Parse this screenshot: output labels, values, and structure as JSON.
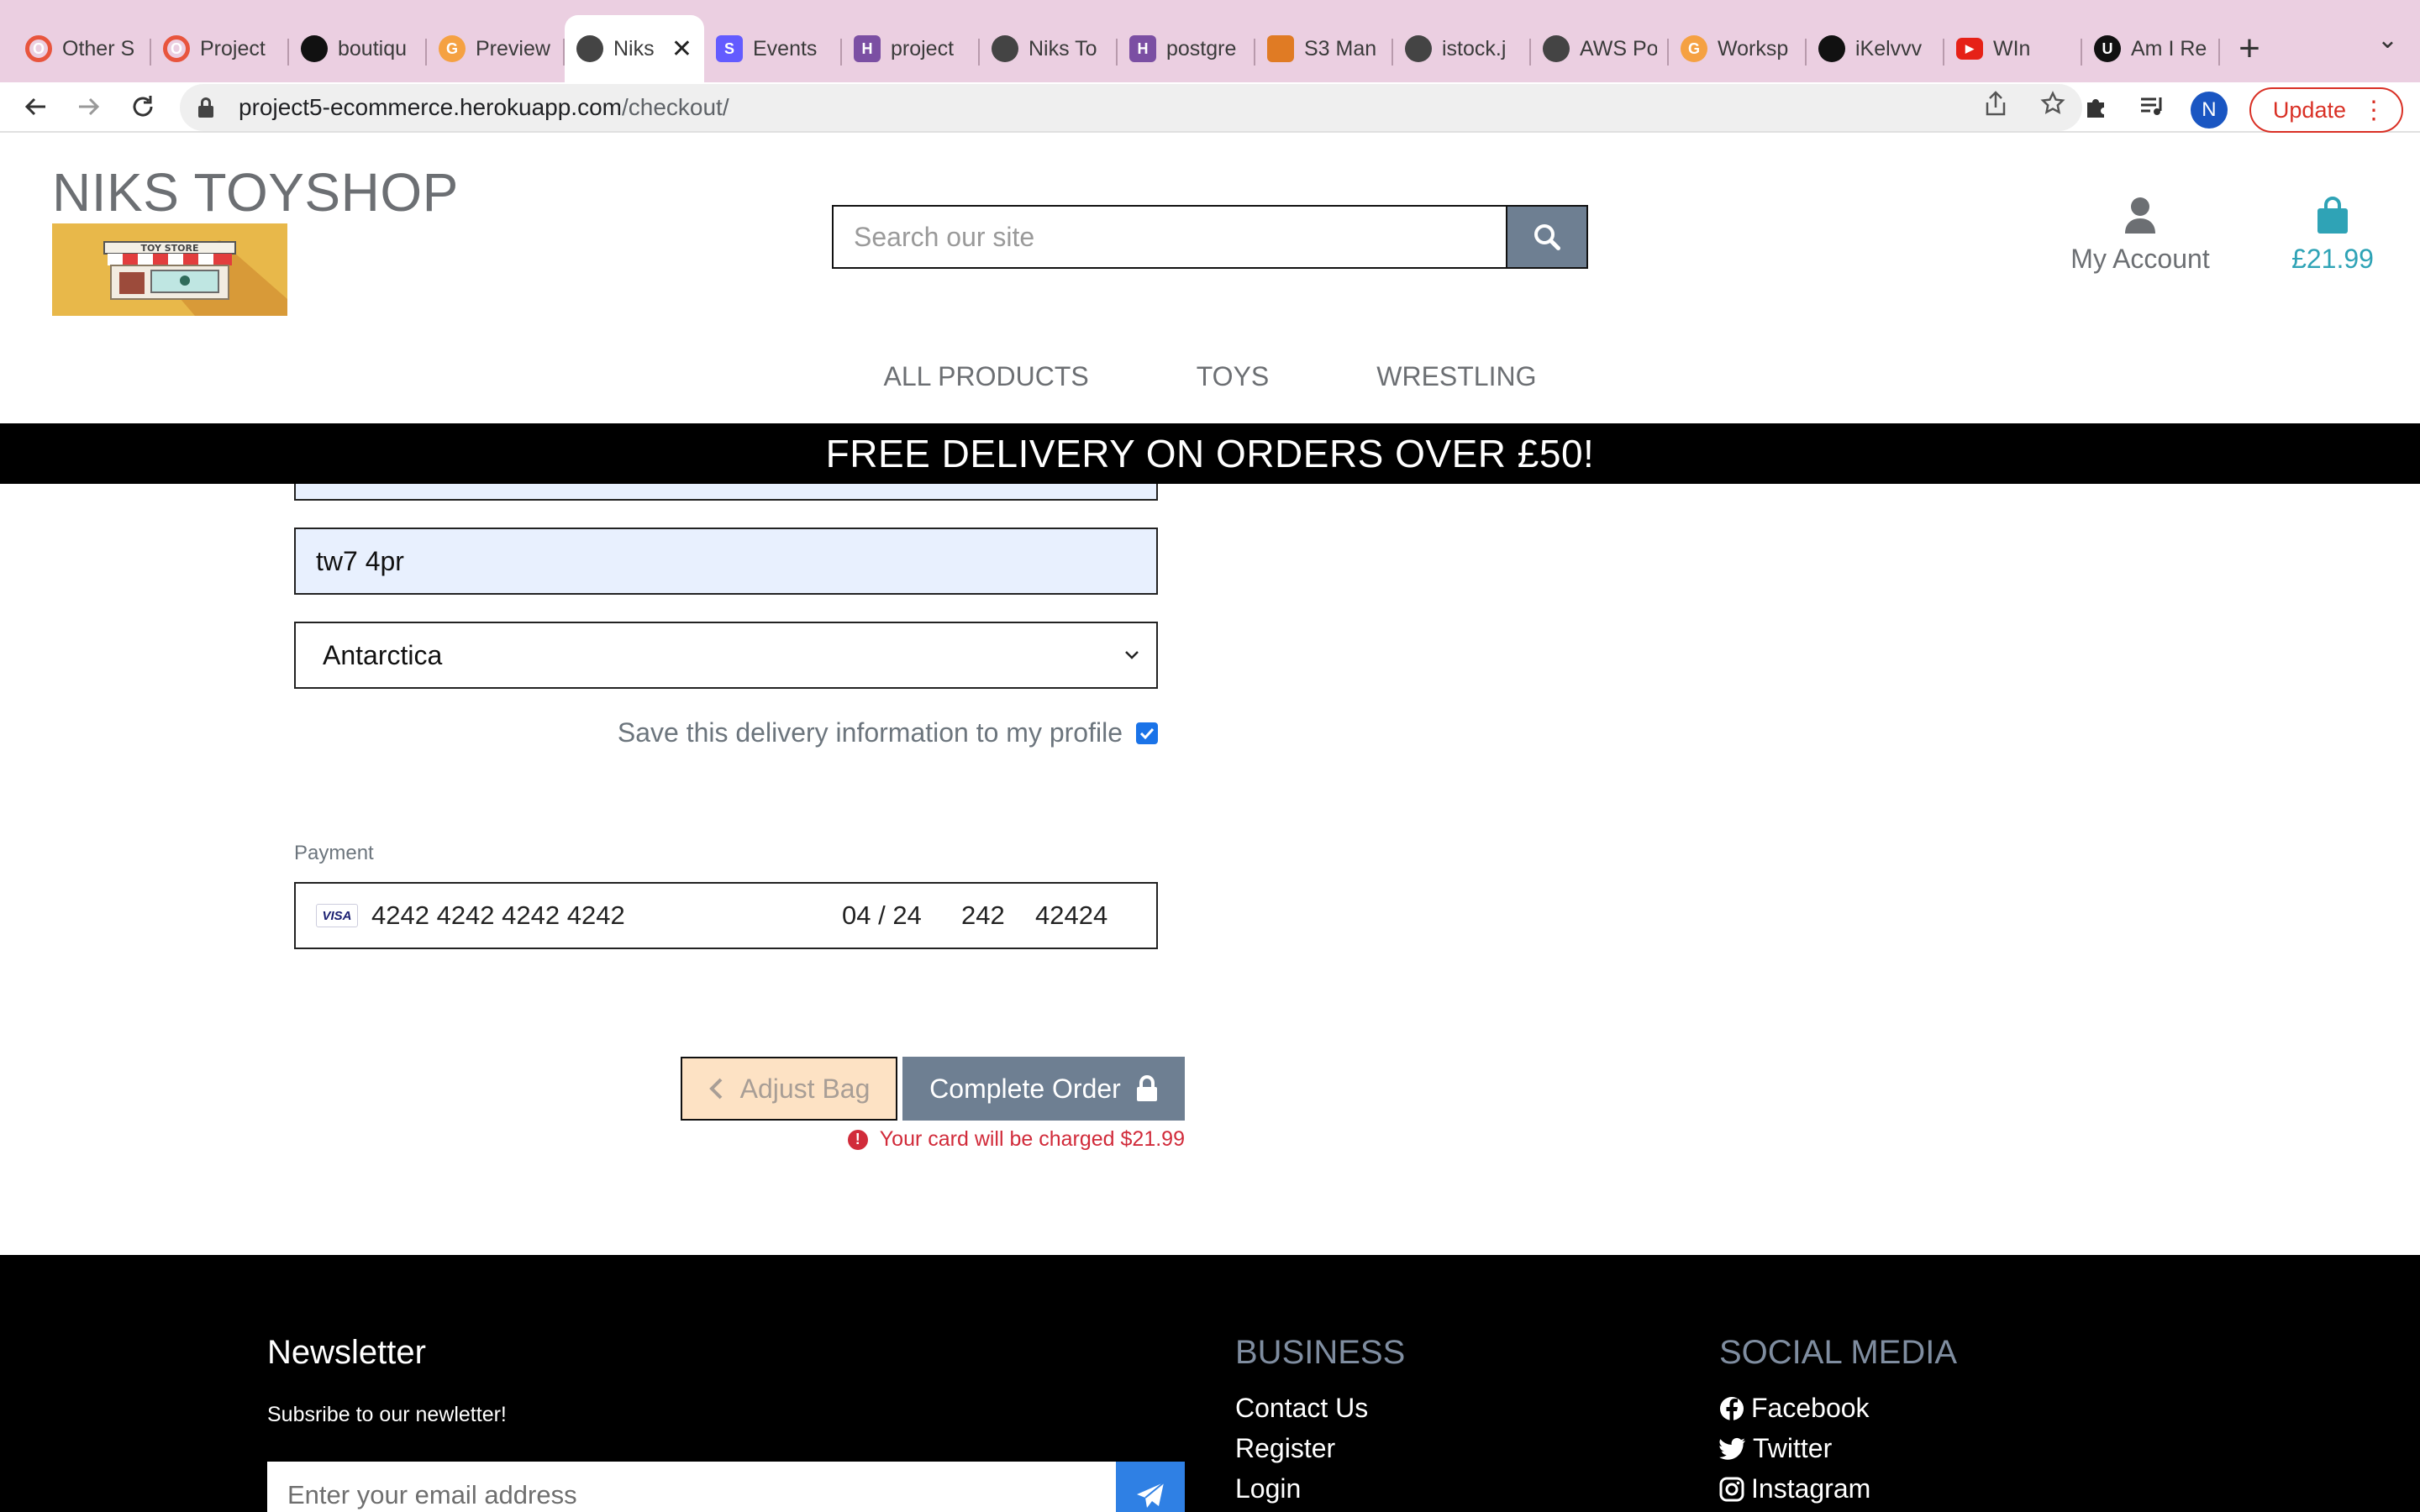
{
  "browser": {
    "tabs": [
      {
        "title": "Other S",
        "favicon": "opera-icon",
        "color": "#e8553d",
        "active": false
      },
      {
        "title": "Project",
        "favicon": "opera-icon",
        "color": "#e8553d",
        "active": false
      },
      {
        "title": "boutiqu",
        "favicon": "github-icon",
        "color": "#111111",
        "active": false
      },
      {
        "title": "Preview",
        "favicon": "gitpod-icon",
        "color": "#f5a142",
        "active": false
      },
      {
        "title": "Niks",
        "favicon": "globe-icon",
        "color": "#444444",
        "active": true
      },
      {
        "title": "Events",
        "favicon": "stripe-icon",
        "color": "#635bff",
        "active": false
      },
      {
        "title": "project",
        "favicon": "heroku-icon",
        "color": "#7b4fa3",
        "active": false
      },
      {
        "title": "Niks To",
        "favicon": "globe-icon",
        "color": "#444444",
        "active": false
      },
      {
        "title": "postgre",
        "favicon": "heroku-icon",
        "color": "#7b4fa3",
        "active": false
      },
      {
        "title": "S3 Man",
        "favicon": "aws-s3-icon",
        "color": "#e07b24",
        "active": false
      },
      {
        "title": "istock.j",
        "favicon": "globe-icon",
        "color": "#444444",
        "active": false
      },
      {
        "title": "AWS Po",
        "favicon": "globe-icon",
        "color": "#444444",
        "active": false
      },
      {
        "title": "Worksp",
        "favicon": "gitpod-icon",
        "color": "#f5a142",
        "active": false
      },
      {
        "title": "iKelvvv",
        "favicon": "github-icon",
        "color": "#111111",
        "active": false
      },
      {
        "title": "WIn",
        "favicon": "youtube-icon",
        "color": "#e62117",
        "active": false
      },
      {
        "title": "Am I Re",
        "favicon": "ui-icon",
        "color": "#111111",
        "active": false
      }
    ],
    "url_host": "project5-ecommerce.herokuapp.com",
    "url_path": "/checkout/",
    "profile_initial": "N",
    "update_label": "Update"
  },
  "site": {
    "brand": "NIKS TOYSHOP",
    "logo_text": "TOY STORE",
    "search_placeholder": "Search our site",
    "account_label": "My Account",
    "bag_total": "£21.99",
    "nav": [
      "ALL PRODUCTS",
      "TOYS",
      "WRESTLING"
    ],
    "banner": "FREE DELIVERY ON ORDERS OVER £50!"
  },
  "checkout": {
    "postcode_value": "tw7 4pr",
    "country_value": "Antarctica",
    "save_info_label": "Save this delivery information to my profile",
    "save_info_checked": true,
    "payment_label": "Payment",
    "card": {
      "brand": "VISA",
      "number": "4242 4242 4242 4242",
      "expiry": "04 / 24",
      "cvc": "242",
      "postal": "42424"
    },
    "adjust_bag_label": "Adjust Bag",
    "complete_order_label": "Complete Order",
    "charge_note": "Your card will be charged $21.99"
  },
  "footer": {
    "newsletter_title": "Newsletter",
    "newsletter_sub": "Subsribe to our newletter!",
    "email_placeholder": "Enter your email address",
    "business_title": "BUSINESS",
    "business_links": [
      "Contact Us",
      "Register",
      "Login"
    ],
    "social_title": "SOCIAL MEDIA",
    "social_links": [
      "Facebook",
      "Twitter",
      "Instagram"
    ]
  },
  "colors": {
    "tabbar_bg": "#ebcfe1",
    "accent_teal": "#2fa3b6",
    "search_button": "#6e7f92",
    "adjust_bag_bg": "#fde2c4",
    "error_red": "#d12b3a",
    "autofill_blue": "#e8f0fe"
  }
}
